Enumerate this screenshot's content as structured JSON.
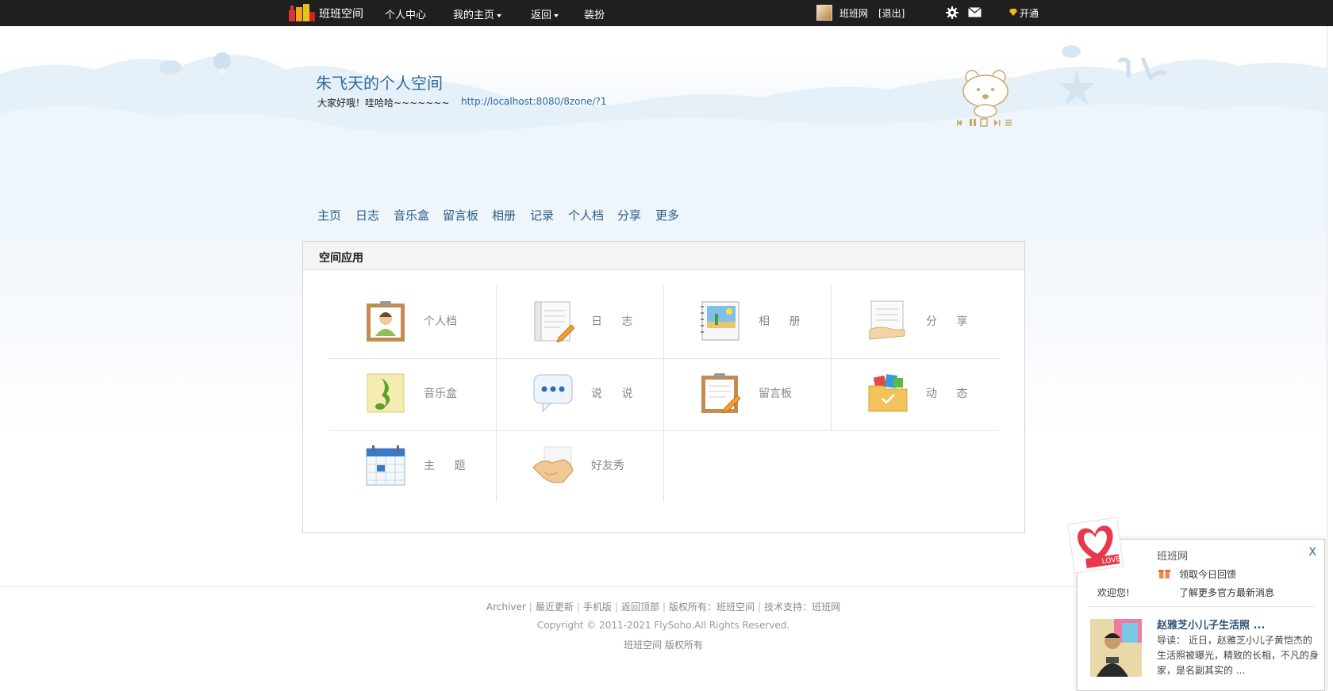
{
  "topbar": {
    "brand": "班班空间",
    "nav": [
      {
        "label": "个人中心",
        "dropdown": false
      },
      {
        "label": "我的主页",
        "dropdown": true
      },
      {
        "label": "返回",
        "dropdown": true
      },
      {
        "label": "装扮",
        "dropdown": false
      }
    ],
    "user": "班班网",
    "logout": "[退出]",
    "vip": "开通"
  },
  "header": {
    "title": "朱飞天的个人空间",
    "description": "大家好哦！哇哈哈~~~~~~~",
    "url": "http://localhost:8080/8zone/?1"
  },
  "space_nav": [
    "主页",
    "日志",
    "音乐盒",
    "留言板",
    "相册",
    "记录",
    "个人档",
    "分享",
    "更多"
  ],
  "panel": {
    "title": "空间应用",
    "apps": [
      {
        "label": "个人档",
        "icon": "profile-clipboard-icon"
      },
      {
        "label": "日 志",
        "icon": "notebook-pencil-icon"
      },
      {
        "label": "相 册",
        "icon": "photo-album-icon"
      },
      {
        "label": "分 享",
        "icon": "share-hand-document-icon"
      },
      {
        "label": "音乐盒",
        "icon": "music-note-icon"
      },
      {
        "label": "说 说",
        "icon": "speech-bubble-icon"
      },
      {
        "label": "留言板",
        "icon": "message-board-clipboard-icon"
      },
      {
        "label": "动 态",
        "icon": "folder-activity-icon"
      },
      {
        "label": "主 题",
        "icon": "calendar-theme-icon"
      },
      {
        "label": "好友秀",
        "icon": "handshake-icon"
      }
    ]
  },
  "footer": {
    "links": [
      "Archiver",
      "最近更新",
      "手机版",
      "返回顶部",
      "版权所有：班班空间",
      "技术支持：班班网"
    ],
    "copyright": "Copyright © 2011-2021 FlySoho.All Rights Reserved.",
    "owner": "班班空间 版权所有"
  },
  "popup": {
    "site": "班班网",
    "close": "X",
    "gift": "领取今日回馈",
    "welcome": "欢迎您!",
    "more": "了解更多官方最新消息",
    "news_title": "赵雅芝小儿子生活照 ...",
    "news_body": "导读： 近日，赵雅芝小儿子黄恺杰的生活照被曝光，精致的长相，不凡的身家，是名副其实的 ..."
  },
  "colors": {
    "topbar": "#1f1f1f",
    "title": "#2e6a9e",
    "nav": "#2c5d86"
  }
}
